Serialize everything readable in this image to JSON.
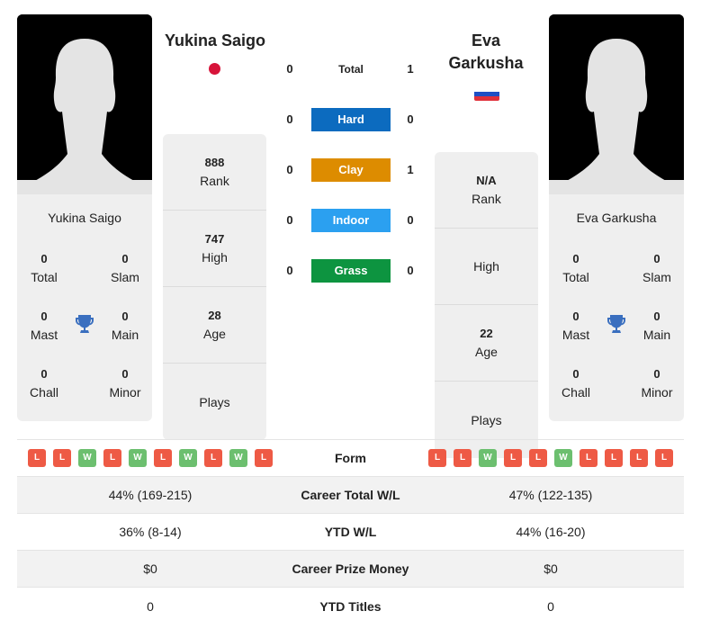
{
  "colors": {
    "hard": "#0c6bbf",
    "clay": "#dd8c00",
    "indoor": "#2ba0f0",
    "grass": "#0d9440",
    "win": "#6cbf6f",
    "loss": "#ee5a45",
    "trophy": "#3a6fbf"
  },
  "player1": {
    "name": "Yukina Saigo",
    "flag": "japan-flag",
    "titles": {
      "total": "0",
      "total_label": "Total",
      "slam": "0",
      "slam_label": "Slam",
      "mast": "0",
      "mast_label": "Mast",
      "main": "0",
      "main_label": "Main",
      "chall": "0",
      "chall_label": "Chall",
      "minor": "0",
      "minor_label": "Minor"
    },
    "stats": {
      "rank": "888",
      "rank_label": "Rank",
      "high": "747",
      "high_label": "High",
      "age": "28",
      "age_label": "Age",
      "plays": "",
      "plays_label": "Plays"
    },
    "form": [
      "L",
      "L",
      "W",
      "L",
      "W",
      "L",
      "W",
      "L",
      "W",
      "L"
    ],
    "career_wl": "44% (169-215)",
    "ytd_wl": "36% (8-14)",
    "prize": "$0",
    "ytd_titles": "0"
  },
  "player2": {
    "name": "Eva Garkusha",
    "name_line1": "Eva",
    "name_line2": "Garkusha",
    "flag": "russia-flag",
    "titles": {
      "total": "0",
      "total_label": "Total",
      "slam": "0",
      "slam_label": "Slam",
      "mast": "0",
      "mast_label": "Mast",
      "main": "0",
      "main_label": "Main",
      "chall": "0",
      "chall_label": "Chall",
      "minor": "0",
      "minor_label": "Minor"
    },
    "stats": {
      "rank": "N/A",
      "rank_label": "Rank",
      "high": "",
      "high_label": "High",
      "age": "22",
      "age_label": "Age",
      "plays": "",
      "plays_label": "Plays"
    },
    "form": [
      "L",
      "L",
      "W",
      "L",
      "L",
      "W",
      "L",
      "L",
      "L",
      "L"
    ],
    "career_wl": "47% (122-135)",
    "ytd_wl": "44% (16-20)",
    "prize": "$0",
    "ytd_titles": "0"
  },
  "h2h": [
    {
      "label": "Total",
      "p1": "0",
      "p2": "1"
    },
    {
      "label": "Hard",
      "p1": "0",
      "p2": "0"
    },
    {
      "label": "Clay",
      "p1": "0",
      "p2": "1"
    },
    {
      "label": "Indoor",
      "p1": "0",
      "p2": "0"
    },
    {
      "label": "Grass",
      "p1": "0",
      "p2": "0"
    }
  ],
  "table": {
    "form_label": "Form",
    "career_wl_label": "Career Total W/L",
    "ytd_wl_label": "YTD W/L",
    "prize_label": "Career Prize Money",
    "ytd_titles_label": "YTD Titles"
  }
}
